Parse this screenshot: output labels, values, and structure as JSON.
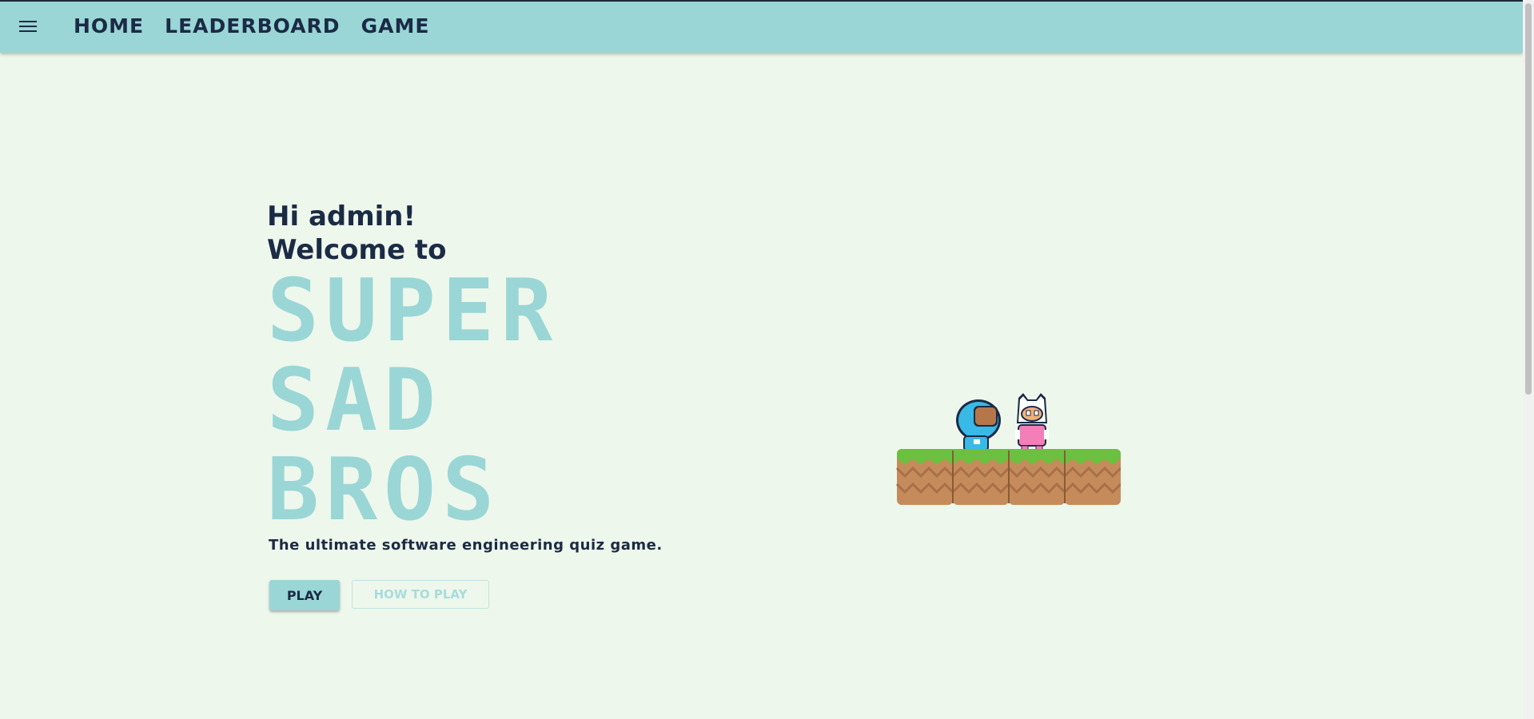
{
  "nav": {
    "menu_icon": "hamburger-menu-icon",
    "items": [
      {
        "label": "HOME"
      },
      {
        "label": "LEADERBOARD"
      },
      {
        "label": "GAME"
      }
    ]
  },
  "hero": {
    "greeting_line1": "Hi admin!",
    "greeting_line2": "Welcome to",
    "title_line1": "SUPER",
    "title_line2": "SAD",
    "title_line3": "BROS",
    "subtitle": "The ultimate software engineering quiz game."
  },
  "actions": {
    "play_label": "PLAY",
    "how_to_play_label": "HOW TO PLAY"
  },
  "colors": {
    "accent": "#9ad6d6",
    "text": "#1b2b45",
    "background": "#eef7ec",
    "grass": "#6cbf3f",
    "dirt": "#c58b5a"
  }
}
